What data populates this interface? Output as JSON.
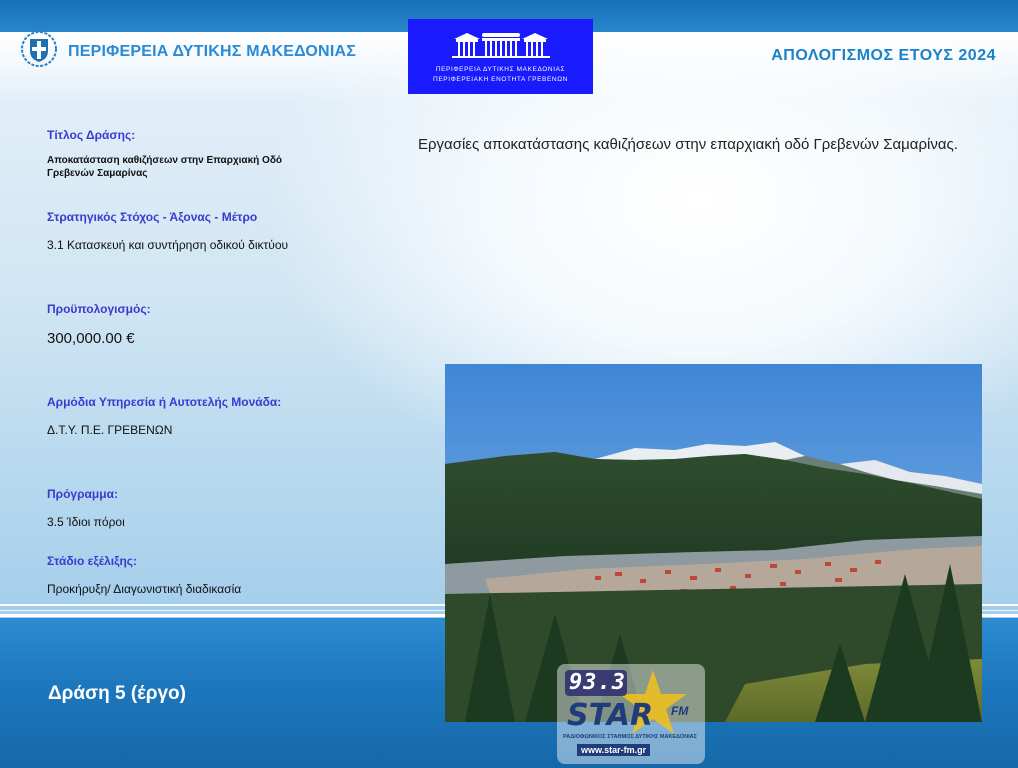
{
  "header": {
    "region": "ΠΕΡΙΦΕΡΕΙΑ ΔΥΤΙΚΗΣ ΜΑΚΕΔΟΝΙΑΣ",
    "report_title": "ΑΠΟΛΟΓΙΣΜΟΣ ΕΤΟΥΣ 2024",
    "logo_line1": "ΠΕΡΙΦΕΡΕΙΑ ΔΥΤΙΚΗΣ ΜΑΚΕΔΟΝΙΑΣ",
    "logo_line2": "ΠΕΡΙΦΕΡΕΙΑΚΗ ΕΝΟΤΗΤΑ ΓΡΕΒΕΝΩΝ"
  },
  "fields": {
    "title_label": "Τίτλος Δράσης:",
    "title_value_1": "Αποκατάσταση καθιζήσεων στην Επαρχιακή Οδό",
    "title_value_2": "Γρεβενών Σαμαρίνας",
    "goal_label": "Στρατηγικός Στόχος - Άξονας - Μέτρο",
    "goal_value": "3.1 Κατασκευή και συντήρηση οδικού δικτύου",
    "budget_label": "Προϋπολογισμός:",
    "budget_value": "300,000.00 €",
    "service_label": "Αρμόδια Υπηρεσία ή Αυτοτελής Μονάδα:",
    "service_value": "Δ.Τ.Υ. Π.Ε. ΓΡΕΒΕΝΩΝ",
    "program_label": "Πρόγραμμα:",
    "program_value": "3.5 Ίδιοι πόροι",
    "stage_label": "Στάδιο εξέλιξης:",
    "stage_value": "Προκήρυξη/ Διαγωνιστική διαδικασία"
  },
  "description": "Εργασίες αποκατάστασης καθιζήσεων στην επαρχιακή οδό Γρεβενών Σαμαρίνας.",
  "footer": {
    "action": "Δράση 5 (έργο)"
  },
  "watermark": {
    "frequency": "93.3",
    "brand": "STAR",
    "band": "FM",
    "tagline": "ΡΑΔΙΟΦΩΝΙΚΟΣ ΣΤΑΘΜΟΣ ΔΥΤΙΚΗΣ ΜΑΚΕΔΟΝΙΑΣ",
    "url": "www.star-fm.gr"
  },
  "colors": {
    "header_blue": "#2a8ad4",
    "label_blue": "#3a3ad0",
    "logo_bg": "#1a1aff",
    "band_blue": "#1d77bd"
  }
}
